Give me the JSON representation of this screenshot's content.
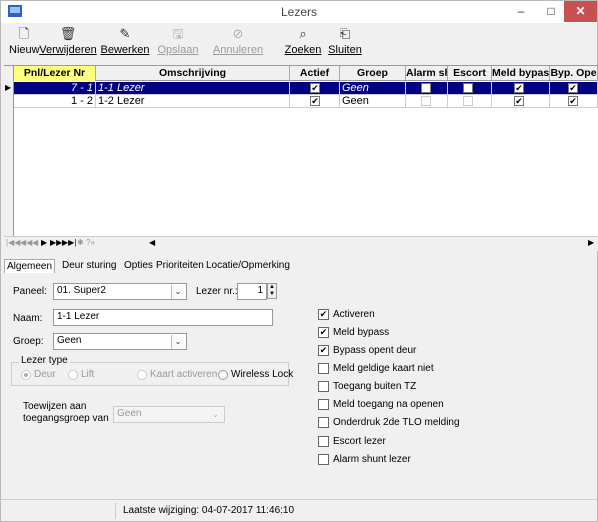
{
  "window": {
    "title": "Lezers",
    "minimize_glyph": "–",
    "maximize_glyph": "□",
    "close_glyph": "✕"
  },
  "toolbar": {
    "new_label": "Nieuw",
    "delete_label": "Verwijderen",
    "edit_label": "Bewerken",
    "save_label": "Opslaan",
    "cancel_label": "Annuleren",
    "search_label": "Zoeken",
    "close_label": "Sluiten"
  },
  "grid": {
    "columns": [
      "Pnl/Lezer Nr",
      "Omschrijving",
      "Actief",
      "Groep",
      "Alarm shu",
      "Escort",
      "Meld bypas",
      "Byp. Ope"
    ],
    "rows": [
      {
        "nr": "7 - 1",
        "omschrijving": "1-1 Lezer",
        "groep": "Geen",
        "actief": "✔",
        "alarm": "",
        "escort": "",
        "meld": "✔",
        "byp": "✔"
      },
      {
        "nr": "1 - 2",
        "omschrijving": "1-2 Lezer",
        "groep": "Geen",
        "actief": "✔",
        "alarm": "",
        "escort": "",
        "meld": "✔",
        "byp": "✔"
      }
    ]
  },
  "tabs": [
    "Algemeen",
    "Deur sturing",
    "Opties",
    "Prioriteiten",
    "Locatie/Opmerking"
  ],
  "form": {
    "panel_label": "Paneel:",
    "panel_value": "01. Super2",
    "reader_nr_label": "Lezer nr.:",
    "reader_nr_value": "1",
    "name_label": "Naam:",
    "name_value": "1-1 Lezer",
    "group_label": "Groep:",
    "group_value": "Geen",
    "reader_type_label": "Lezer type",
    "type_door": "Deur",
    "type_lift": "Lift",
    "type_card": "Kaart activeren",
    "type_wireless": "Wireless Lock",
    "assign_label_1": "Toewijzen aan",
    "assign_label_2": "toegangsgroep van",
    "assign_value": "Geen"
  },
  "options": [
    {
      "label": "Activeren",
      "checked": "✔"
    },
    {
      "label": "Meld bypass",
      "checked": "✔"
    },
    {
      "label": "Bypass opent deur",
      "checked": "✔"
    },
    {
      "label": "Meld geldige kaart niet",
      "checked": ""
    },
    {
      "label": "Toegang buiten TZ",
      "checked": ""
    },
    {
      "label": "Meld toegang na openen",
      "checked": ""
    },
    {
      "label": "Onderdruk 2de TLO melding",
      "checked": ""
    },
    {
      "label": "Escort lezer",
      "checked": ""
    },
    {
      "label": "Alarm shunt lezer",
      "checked": ""
    }
  ],
  "status": {
    "last_change": "Laatste wijziging: 04-07-2017 11:46:10"
  },
  "colors": {
    "selected_row": "#000080",
    "sorted_header": "#ffff80",
    "close_button": "#c75050"
  }
}
